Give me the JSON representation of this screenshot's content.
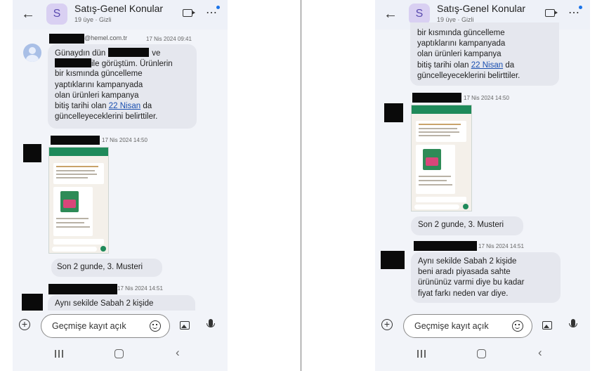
{
  "chat": {
    "title": "Satış-Genel Konular",
    "subtitle": "19 üye  ·  Gizli",
    "initial": "S"
  },
  "composer": {
    "placeholder": "Geçmişe kayıt açık"
  },
  "left": {
    "msg1": {
      "email_suffix": "@hemel.com.tr",
      "time": "17 Nis 2024 09:41",
      "l1_a": "Günaydın dün",
      "l1_b": "ve",
      "l2": "ile görüştüm. Ürünlerin",
      "l3": "bir kısmında güncelleme",
      "l4": "yaptıklarını kampanyada",
      "l5": "olan ürünleri kampanya",
      "l6_a": "bitiş tarihi olan",
      "l6_link": "22 Nisan",
      "l6_b": "da",
      "l7": "güncelleyeceklerini belirttiler."
    },
    "msg2": {
      "time": "17 Nis 2024 14:50"
    },
    "msg3": {
      "text": "Son 2 gunde, 3. Musteri"
    },
    "msg4": {
      "time": "17 Nis 2024 14:51",
      "text": "Aynı sekilde Sabah 2 kişide"
    }
  },
  "right": {
    "msg1": {
      "l1": "bir kısmında güncelleme",
      "l2": "yaptıklarını kampanyada",
      "l3": "olan ürünleri kampanya",
      "l4_a": "bitiş tarihi olan",
      "l4_link": "22 Nisan",
      "l4_b": "da",
      "l5": "güncelleyeceklerini belirttiler."
    },
    "msg2": {
      "time": "17 Nis 2024 14:50"
    },
    "msg3": {
      "text": "Son 2 gunde, 3. Musteri"
    },
    "msg4": {
      "time": "17 Nis 2024 14:51",
      "l1": "Aynı sekilde Sabah 2 kişide",
      "l2": "beni aradı  piyasada sahte",
      "l3": "ürününüz  varmi diye bu kadar",
      "l4": "fiyat farkı neden var diye."
    }
  },
  "colors": {
    "link": "#1a4fb0",
    "bubble": "#e5e7ee",
    "background": "#f2f4f9",
    "accent": "#1a73e8"
  },
  "icons": [
    "back-arrow-icon",
    "video-call-icon",
    "more-options-icon",
    "add-icon",
    "emoji-icon",
    "image-icon",
    "microphone-icon",
    "recent-apps-icon",
    "home-icon",
    "nav-back-icon"
  ]
}
